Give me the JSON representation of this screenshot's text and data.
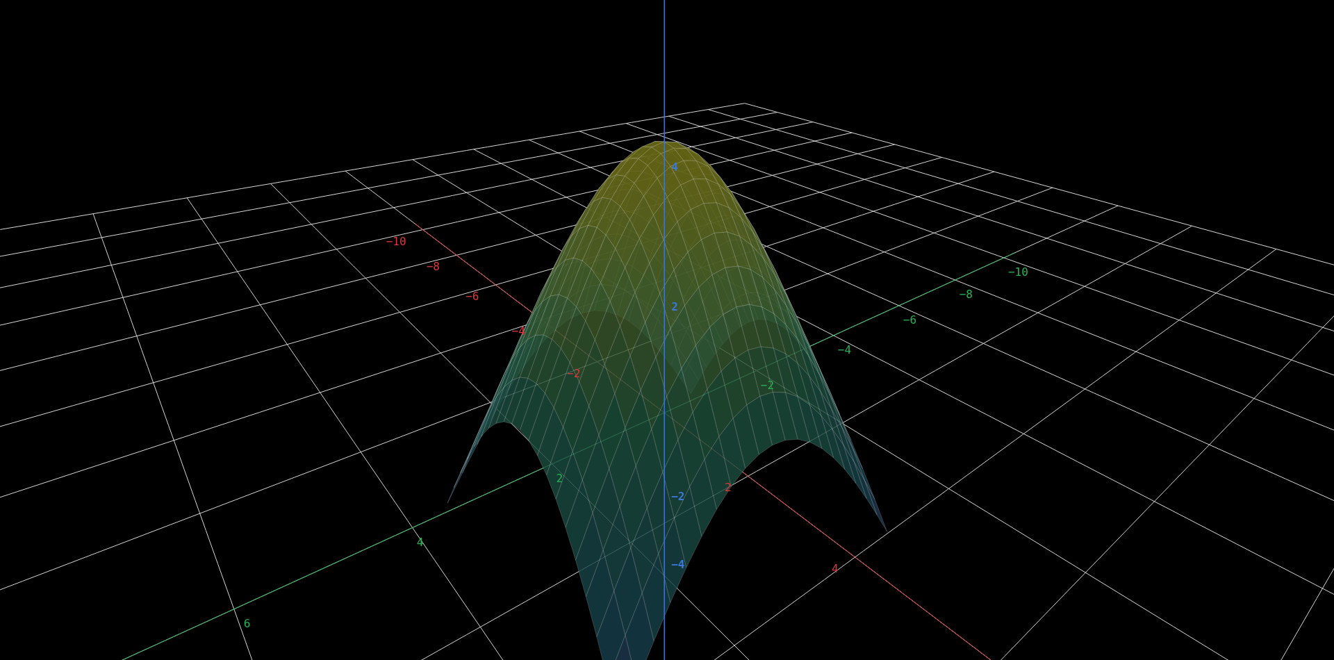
{
  "axes": [
    {
      "color": "#e0383c",
      "ticks": [
        "−10",
        "−8",
        "−6",
        "−4",
        "−2",
        "2",
        "4"
      ]
    },
    {
      "color": "#22b455",
      "ticks": [
        "−10",
        "−8",
        "−6",
        "−4",
        "−2",
        "2",
        "4",
        "6"
      ]
    },
    {
      "color": "#3b78d8",
      "ticks": [
        "4",
        "2",
        "−2",
        "−4"
      ]
    }
  ]
}
